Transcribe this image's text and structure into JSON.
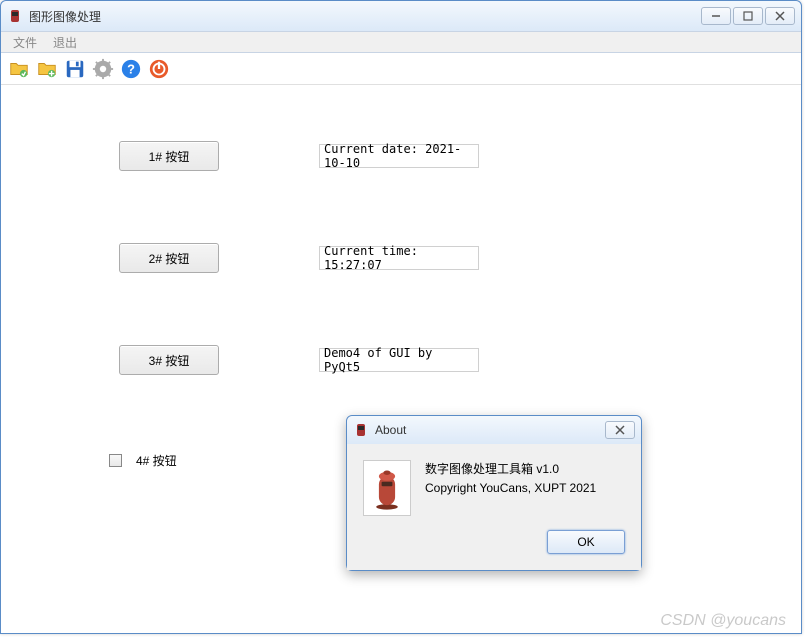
{
  "window": {
    "title": "图形图像处理"
  },
  "menubar": {
    "file": "文件",
    "exit": "退出"
  },
  "toolbar": {
    "icons": [
      "folder-open-icon",
      "folder-add-icon",
      "save-icon",
      "gear-icon",
      "help-icon",
      "power-icon"
    ]
  },
  "rows": {
    "r1": {
      "button": "1# 按钮",
      "text": "Current date: 2021-10-10"
    },
    "r2": {
      "button": "2# 按钮",
      "text": "Current time: 15:27:07"
    },
    "r3": {
      "button": "3# 按钮",
      "text": "Demo4 of GUI by PyQt5"
    },
    "r4": {
      "label": "4# 按钮"
    }
  },
  "dialog": {
    "title": "About",
    "line1": "数字图像处理工具箱 v1.0",
    "line2": "Copyright YouCans, XUPT 2021",
    "ok": "OK"
  },
  "watermark": "CSDN @youcans"
}
